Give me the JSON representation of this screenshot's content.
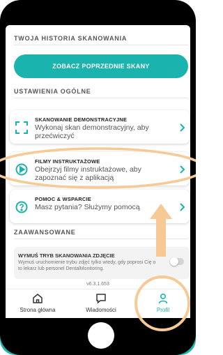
{
  "history": {
    "section_title": "TWOJA HISTORIA SKANOWANIA",
    "cta_label": "ZOBACZ POPRZEDNIE SKANY"
  },
  "settings": {
    "section_title": "USTAWIENIA OGÓLNE",
    "items": [
      {
        "title": "SKANOWANIE DEMONSTRACYJNE",
        "description": "Wykonaj skan demonstracyjny, aby przećwiczyć",
        "icon": "scan-frame-icon"
      },
      {
        "title": "FILMY INSTRUKTAŻOWE",
        "description": "Obejrzyj filmy instruktażowe, aby zapoznać się z aplikacją",
        "icon": "play-icon"
      },
      {
        "title": "POMOC & WSPARCIE",
        "description": "Masz pytania? Służymy pomocą",
        "icon": "help-icon"
      }
    ]
  },
  "advanced": {
    "section_title": "ZAAWANSOWANE",
    "force_photo_mode": {
      "title": "WYMUŚ TRYB SKANOWANIA ZDJĘCIE",
      "description": "Wymuś uruchomienie trybu zdjęć tylko wtedy, gdy poprosi Cię o to lekarz lub personel DentalMonitoring.",
      "enabled": false
    }
  },
  "version": "v6.3.1.653",
  "tabbar": {
    "tabs": [
      {
        "label": "Strona główna",
        "icon": "home-icon",
        "active": false
      },
      {
        "label": "Wiadomości",
        "icon": "message-icon",
        "active": false
      },
      {
        "label": "Profil",
        "icon": "profile-icon",
        "active": true
      }
    ]
  },
  "colors": {
    "accent": "#1ab3ad",
    "highlight": "#f7c995"
  }
}
